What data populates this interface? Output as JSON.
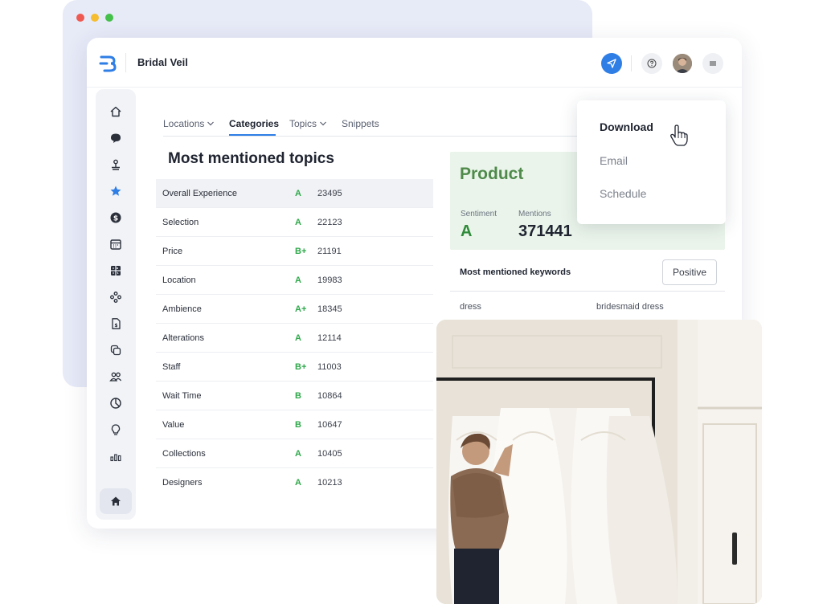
{
  "app": {
    "title": "Bridal Veil"
  },
  "tabs": [
    {
      "label": "Locations",
      "has_chevron": true
    },
    {
      "label": "Categories",
      "active": true
    },
    {
      "label": "Topics",
      "has_chevron": true
    },
    {
      "label": "Snippets"
    }
  ],
  "topics": {
    "title": "Most mentioned topics",
    "rows": [
      {
        "name": "Overall Experience",
        "grade": "A",
        "count": "23495"
      },
      {
        "name": "Selection",
        "grade": "A",
        "count": "22123"
      },
      {
        "name": "Price",
        "grade": "B+",
        "count": "21191"
      },
      {
        "name": "Location",
        "grade": "A",
        "count": "19983"
      },
      {
        "name": "Ambience",
        "grade": "A+",
        "count": "18345"
      },
      {
        "name": "Alterations",
        "grade": "A",
        "count": "12114"
      },
      {
        "name": "Staff",
        "grade": "B+",
        "count": "11003"
      },
      {
        "name": "Wait Time",
        "grade": "B",
        "count": "10864"
      },
      {
        "name": "Value",
        "grade": "B",
        "count": "10647"
      },
      {
        "name": "Collections",
        "grade": "A",
        "count": "10405"
      },
      {
        "name": "Designers",
        "grade": "A",
        "count": "10213"
      }
    ]
  },
  "product": {
    "title": "Product",
    "sentiment_label": "Sentiment",
    "sentiment_value": "A",
    "mentions_label": "Mentions",
    "mentions_value": "371441"
  },
  "keywords": {
    "title": "Most mentioned keywords",
    "filter_button": "Positive",
    "items": [
      "dress",
      "bridesmaid dress"
    ]
  },
  "dropdown": {
    "items": [
      "Download",
      "Email",
      "Schedule"
    ]
  },
  "sidebar": {
    "icons": [
      "home-icon",
      "chat-icon",
      "location-pin-icon",
      "star-icon",
      "dollar-icon",
      "calendar-icon",
      "grid-icon",
      "nodes-icon",
      "document-icon",
      "copy-icon",
      "users-icon",
      "pie-chart-icon",
      "lightbulb-icon",
      "bar-chart-icon"
    ],
    "bottom_icon": "home-icon"
  },
  "colors": {
    "accent": "#2f7ee6",
    "grade_green": "#2ea84a",
    "product_card": "#eaf4ea",
    "traffic_red": "#ee5a52",
    "traffic_yellow": "#f5bd2f",
    "traffic_green": "#45c04a"
  }
}
